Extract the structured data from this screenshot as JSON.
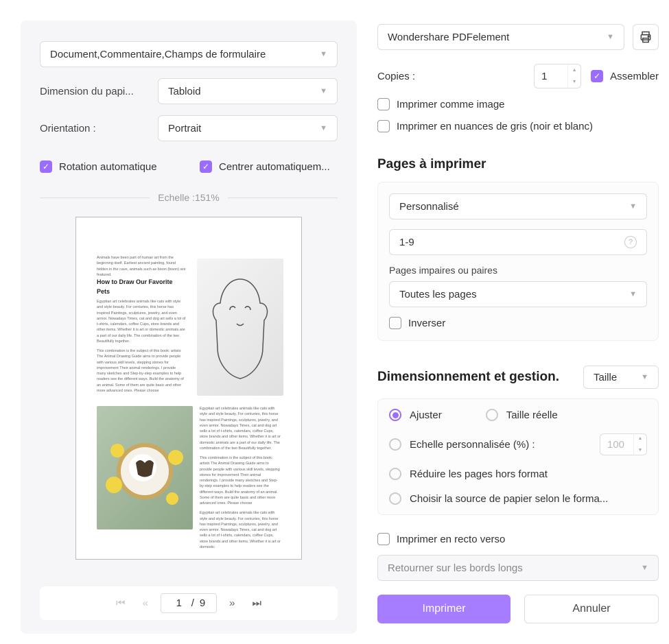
{
  "left": {
    "content_select": "Document,Commentaire,Champs de formulaire",
    "paper_size_label": "Dimension du papi...",
    "paper_size_value": "Tabloid",
    "orientation_label": "Orientation :",
    "orientation_value": "Portrait",
    "auto_rotate": "Rotation automatique",
    "auto_center": "Centrer automatiquem...",
    "scale_label": "Echelle :151%",
    "preview": {
      "intro": "Animals have been part of human art from the beginning itself. Earliest ancient painting, found hidden in the cave, animals such as bison (bison) are featured.",
      "heading": "How to Draw Our Favorite Pets",
      "p1": "Egyptian art celebrates animals like cats with style and style beauty. For centuries, this horse has inspired Paintings, sculptures, jewelry, and even armor. Nowadays Times, cat and dog art sells a lot of t-shirts, calendars, coffee Cups, store brands and other items. Whether it is art or domestic animals are a part of our daily life. The combination of the two Beautifully together.",
      "p2": "This combination is the subject of this book: artists The Animal Drawing Guide aims to provide people with various skill levels, stepping stones for improvement Their animal renderings. I provide many sketches and Step-by-step examples to help readers see the different ways. Build the anatomy of an animal. Some of them are quite basic and other more advanced ones. Please choose",
      "p3": "Egyptian art celebrates animals like cats with style and style beauty. For centuries, this horse has inspired Paintings, sculptures, jewelry, and even armor. Nowadays Times, cat and dog art sells a lot of t-shirts, calendars, coffee Cups, store brands and other items. Whether it is art or domestic animals are a part of our daily life. The combination of the two Beautifully together.",
      "p4": "This combination is the subject of this book: artists The Animal Drawing Guide aims to provide people with various skill levels, stepping stones for improvement Their animal renderings. I provide many sketches and Step-by-step examples to help readers see the different ways. Build the anatomy of an animal. Some of them are quite basic and other more advanced ones. Please choose",
      "p5": "Egyptian art celebrates animals like cats with style and style beauty. For centuries, this horse has inspired Paintings, sculptures, jewelry, and even armor. Nowadays Times, cat and dog art sells a lot of t-shirts, calendars, coffee Cups, store brands and other items. Whether it is art or domestic"
    },
    "pager": {
      "current": "1",
      "sep": "/",
      "total": "9"
    }
  },
  "right": {
    "printer": "Wondershare PDFelement",
    "copies_label": "Copies :",
    "copies_value": "1",
    "assemble": "Assembler",
    "print_as_image": "Imprimer comme image",
    "print_grayscale": "Imprimer en nuances de gris (noir et blanc)",
    "pages_title": "Pages à imprimer",
    "pages_select": "Personnalisé",
    "pages_range": "1-9",
    "odd_even_label": "Pages impaires ou paires",
    "odd_even_value": "Toutes les pages",
    "reverse": "Inverser",
    "dim_title": "Dimensionnement et gestion.",
    "dim_mode": "Taille",
    "radios": {
      "fit": "Ajuster",
      "actual": "Taille réelle",
      "custom_scale": "Echelle personnalisée (%) :",
      "custom_scale_value": "100",
      "shrink": "Réduire les pages hors format",
      "choose_source": "Choisir la source de papier selon le forma..."
    },
    "duplex": "Imprimer en recto verso",
    "flip": "Retourner sur les bords longs",
    "print_btn": "Imprimer",
    "cancel_btn": "Annuler"
  }
}
